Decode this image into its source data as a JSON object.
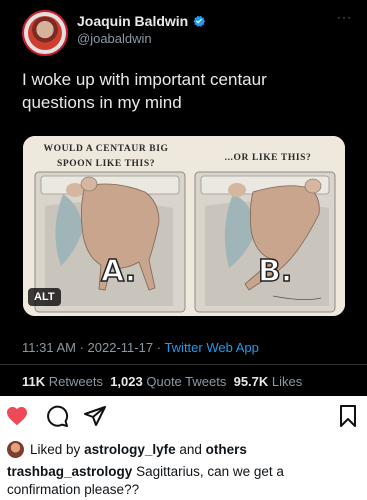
{
  "tweet": {
    "author_name": "Joaquin Baldwin",
    "handle": "@joabaldwin",
    "more": "···",
    "text": "I woke up with important centaur questions in my mind",
    "media": {
      "caption_left": "Would a centaur big spoon like this?",
      "caption_right": "...or like this?",
      "label_a": "A.",
      "label_b": "B.",
      "alt_badge": "ALT"
    },
    "time": "11:31 AM",
    "date": "2022-11-17",
    "source": "Twitter Web App",
    "retweets_count": "11K",
    "retweets_label": "Retweets",
    "quotes_count": "1,023",
    "quotes_label": "Quote Tweets",
    "likes_count": "95.7K",
    "likes_label": "Likes"
  },
  "instagram": {
    "liked_prefix": "Liked by",
    "liked_user": "astrology_lyfe",
    "liked_and": "and",
    "liked_others": "others",
    "caption_user": "trashbag_astrology",
    "caption_text": "Sagittarius, can we get a confirmation please??"
  },
  "colors": {
    "tweet_bg": "#000000",
    "link_blue": "#1d9bf0",
    "verified_blue": "#1d9bf0",
    "heart_red": "#ed4956"
  },
  "icons": [
    "verified-icon",
    "heart-icon",
    "comment-icon",
    "share-icon",
    "bookmark-icon"
  ]
}
